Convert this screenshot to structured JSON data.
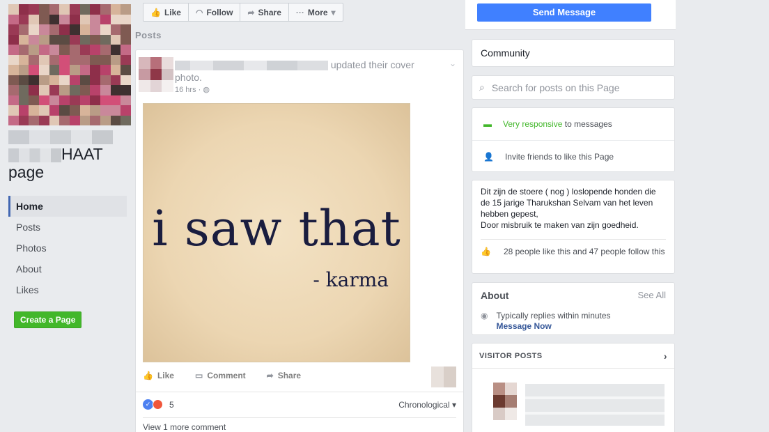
{
  "page": {
    "name_suffix": "HAAT",
    "name_second_line": "page"
  },
  "nav": {
    "items": [
      "Home",
      "Posts",
      "Photos",
      "About",
      "Likes"
    ],
    "active": "Home"
  },
  "create_page_label": "Create a Page",
  "top_actions": {
    "like": "Like",
    "follow": "Follow",
    "share": "Share",
    "more": "More"
  },
  "send_message_label": "Send Message",
  "posts_section_title": "Posts",
  "post": {
    "action_text": "updated their cover",
    "action_text_line2": "photo.",
    "time": "16 hrs",
    "image_text_main": "i saw that",
    "image_text_sub": "- karma",
    "actions": {
      "like": "Like",
      "comment": "Comment",
      "share": "Share"
    },
    "reaction_count": "5",
    "sort_label": "Chronological",
    "more_comments": "View 1 more comment"
  },
  "right": {
    "community_label": "Community",
    "search_placeholder": "Search for posts on this Page",
    "responsive_highlight": "Very responsive",
    "responsive_rest": "to messages",
    "invite_label": "Invite friends to like this Page",
    "description": "Dit zijn de stoere ( nog ) loslopende honden die de 15 jarige Tharukshan Selvam van het leven hebben gepest,",
    "description_line2": "Door misbruik te maken van zijn goedheid.",
    "likes_text": "28 people like this and 47 people follow this",
    "about_title": "About",
    "see_all": "See All",
    "replies_text": "Typically replies within minutes",
    "message_now": "Message Now",
    "visitor_posts_title": "VISITOR POSTS"
  },
  "colors": {
    "background": "#e9ebee",
    "send_message": "#4080ff",
    "create_page": "#42b72a",
    "responsive_green": "#42b72a",
    "link_blue": "#365899"
  }
}
